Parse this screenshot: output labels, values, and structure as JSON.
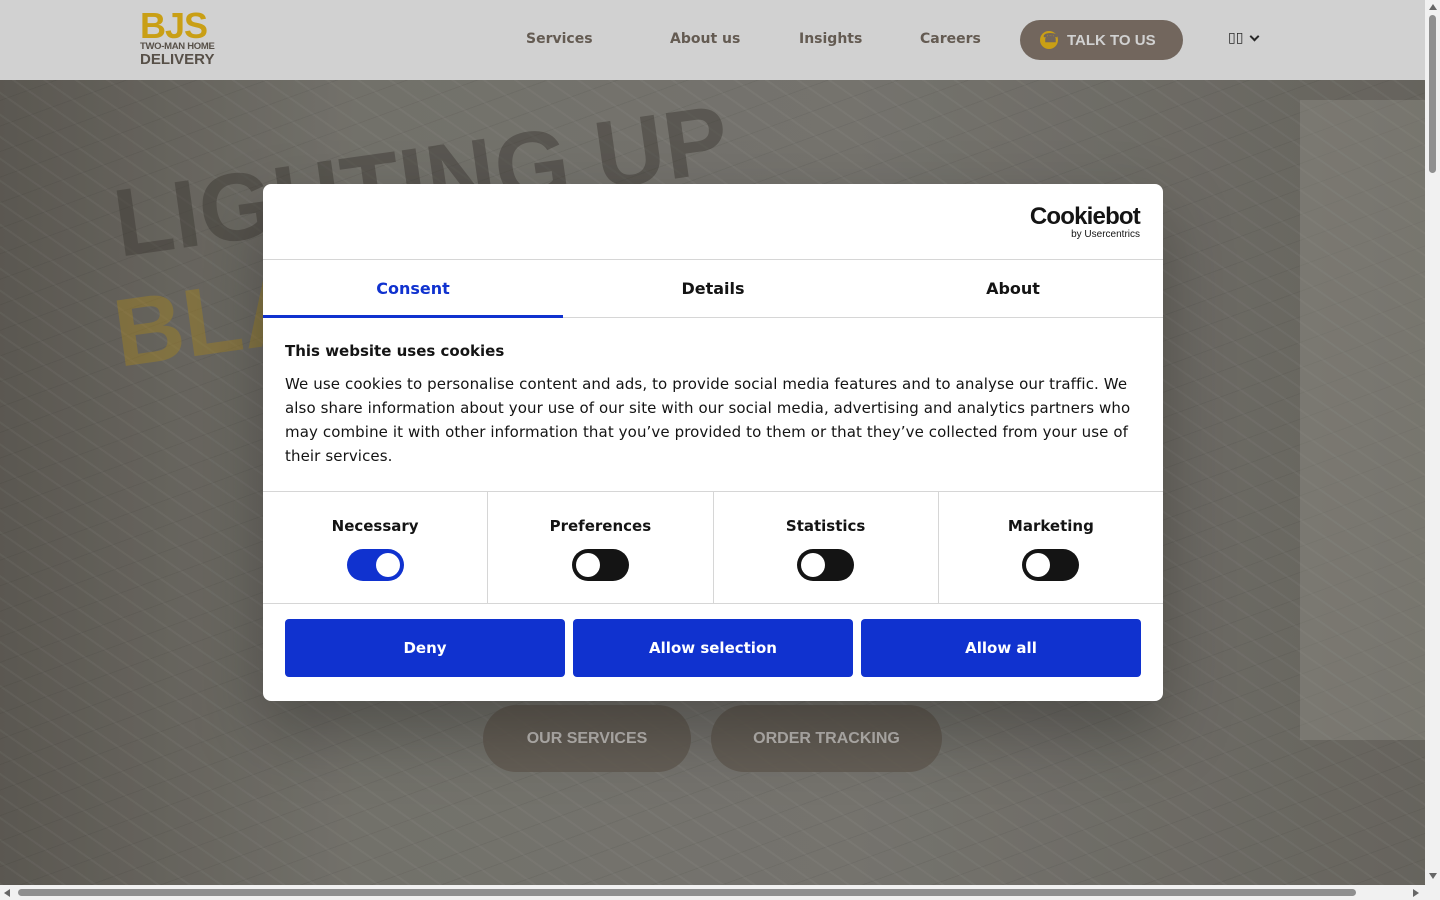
{
  "header": {
    "logo": {
      "brand": "BJS",
      "line1": "TWO-MAN HOME",
      "line2": "DELIVERY"
    },
    "nav": [
      "Services",
      "About us",
      "Insights",
      "Careers"
    ],
    "cta_label": "TALK TO US",
    "language_label": "▯▯"
  },
  "hero": {
    "background_text_1": "LIGHTING UP",
    "background_text_2": "BLACK",
    "buttons": [
      "OUR SERVICES",
      "ORDER TRACKING"
    ]
  },
  "cookie_dialog": {
    "provider": {
      "name": "Cookiebot",
      "tagline": "by Usercentrics"
    },
    "tabs": [
      {
        "label": "Consent",
        "active": true
      },
      {
        "label": "Details",
        "active": false
      },
      {
        "label": "About",
        "active": false
      }
    ],
    "title": "This website uses cookies",
    "text": "We use cookies to personalise content and ads, to provide social media features and to analyse our traffic. We also share information about your use of our site with our social media, advertising and analytics partners who may combine it with other information that you’ve provided to them or that they’ve collected from your use of their services.",
    "toggles": [
      {
        "label": "Necessary",
        "on": true
      },
      {
        "label": "Preferences",
        "on": false
      },
      {
        "label": "Statistics",
        "on": false
      },
      {
        "label": "Marketing",
        "on": false
      }
    ],
    "actions": [
      "Deny",
      "Allow selection",
      "Allow all"
    ]
  },
  "colors": {
    "accent_blue": "#1032cf",
    "brand_yellow": "#f6c21a",
    "brand_brown": "#8b7d72"
  }
}
